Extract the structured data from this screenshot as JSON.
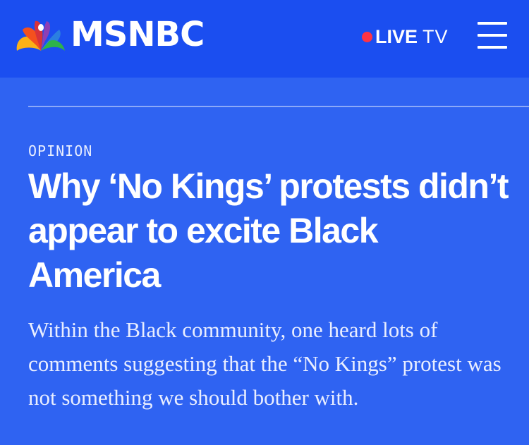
{
  "header": {
    "brand": "MSNBC",
    "live_label": "LIVE",
    "tv_label": "TV",
    "menu_icon": "hamburger-menu-icon",
    "colors": {
      "bar": "#1b4ef0",
      "live_dot": "#ff3344"
    }
  },
  "article": {
    "kicker": "OPINION",
    "headline": "Why ‘No Kings’ protests didn’t appear to excite Black America",
    "dek": "Within the Black community, one heard lots of comments suggesting that the “No Kings” protest was not something we should bother with.",
    "background": "#2f63f2"
  }
}
